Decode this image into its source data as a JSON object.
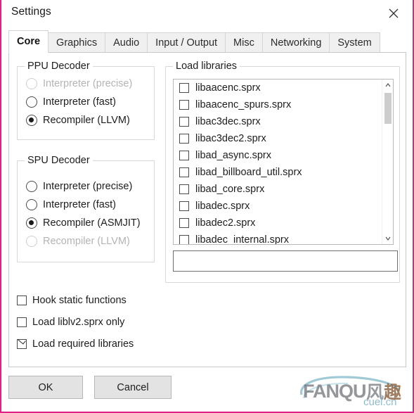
{
  "window": {
    "title": "Settings",
    "close_icon": "close-icon",
    "border_color": "#e0218a"
  },
  "tabs": [
    {
      "label": "Core",
      "active": true
    },
    {
      "label": "Graphics",
      "active": false
    },
    {
      "label": "Audio",
      "active": false
    },
    {
      "label": "Input / Output",
      "active": false
    },
    {
      "label": "Misc",
      "active": false
    },
    {
      "label": "Networking",
      "active": false
    },
    {
      "label": "System",
      "active": false
    }
  ],
  "ppu_decoder": {
    "title": "PPU Decoder",
    "options": [
      {
        "label": "Interpreter (precise)",
        "checked": false,
        "disabled": true
      },
      {
        "label": "Interpreter (fast)",
        "checked": false,
        "disabled": false
      },
      {
        "label": "Recompiler (LLVM)",
        "checked": true,
        "disabled": false
      }
    ]
  },
  "spu_decoder": {
    "title": "SPU Decoder",
    "options": [
      {
        "label": "Interpreter (precise)",
        "checked": false,
        "disabled": false
      },
      {
        "label": "Interpreter (fast)",
        "checked": false,
        "disabled": false
      },
      {
        "label": "Recompiler (ASMJIT)",
        "checked": true,
        "disabled": false
      },
      {
        "label": "Recompiler (LLVM)",
        "checked": false,
        "disabled": true
      }
    ]
  },
  "load_libraries": {
    "title": "Load libraries",
    "items": [
      {
        "label": "libaacenc.sprx",
        "checked": false
      },
      {
        "label": "libaacenc_spurs.sprx",
        "checked": false
      },
      {
        "label": "libac3dec.sprx",
        "checked": false
      },
      {
        "label": "libac3dec2.sprx",
        "checked": false
      },
      {
        "label": "libad_async.sprx",
        "checked": false
      },
      {
        "label": "libad_billboard_util.sprx",
        "checked": false
      },
      {
        "label": "libad_core.sprx",
        "checked": false
      },
      {
        "label": "libadec.sprx",
        "checked": false
      },
      {
        "label": "libadec2.sprx",
        "checked": false
      },
      {
        "label": "libadec_internal.sprx",
        "checked": false
      }
    ],
    "filter": {
      "value": "",
      "placeholder": ""
    },
    "scrollbar": {
      "up_icon": "chevron-up-icon",
      "down_icon": "chevron-down-icon"
    }
  },
  "options": [
    {
      "label": "Hook static functions",
      "checked": false
    },
    {
      "label": "Load liblv2.sprx only",
      "checked": false
    },
    {
      "label": "Load required libraries",
      "checked": true
    }
  ],
  "buttons": {
    "ok": "OK",
    "cancel": "Cancel"
  },
  "watermark": {
    "brand": "FANQU",
    "cn1": "风",
    "cn2": "趣",
    "domain": "cuel.cn"
  }
}
